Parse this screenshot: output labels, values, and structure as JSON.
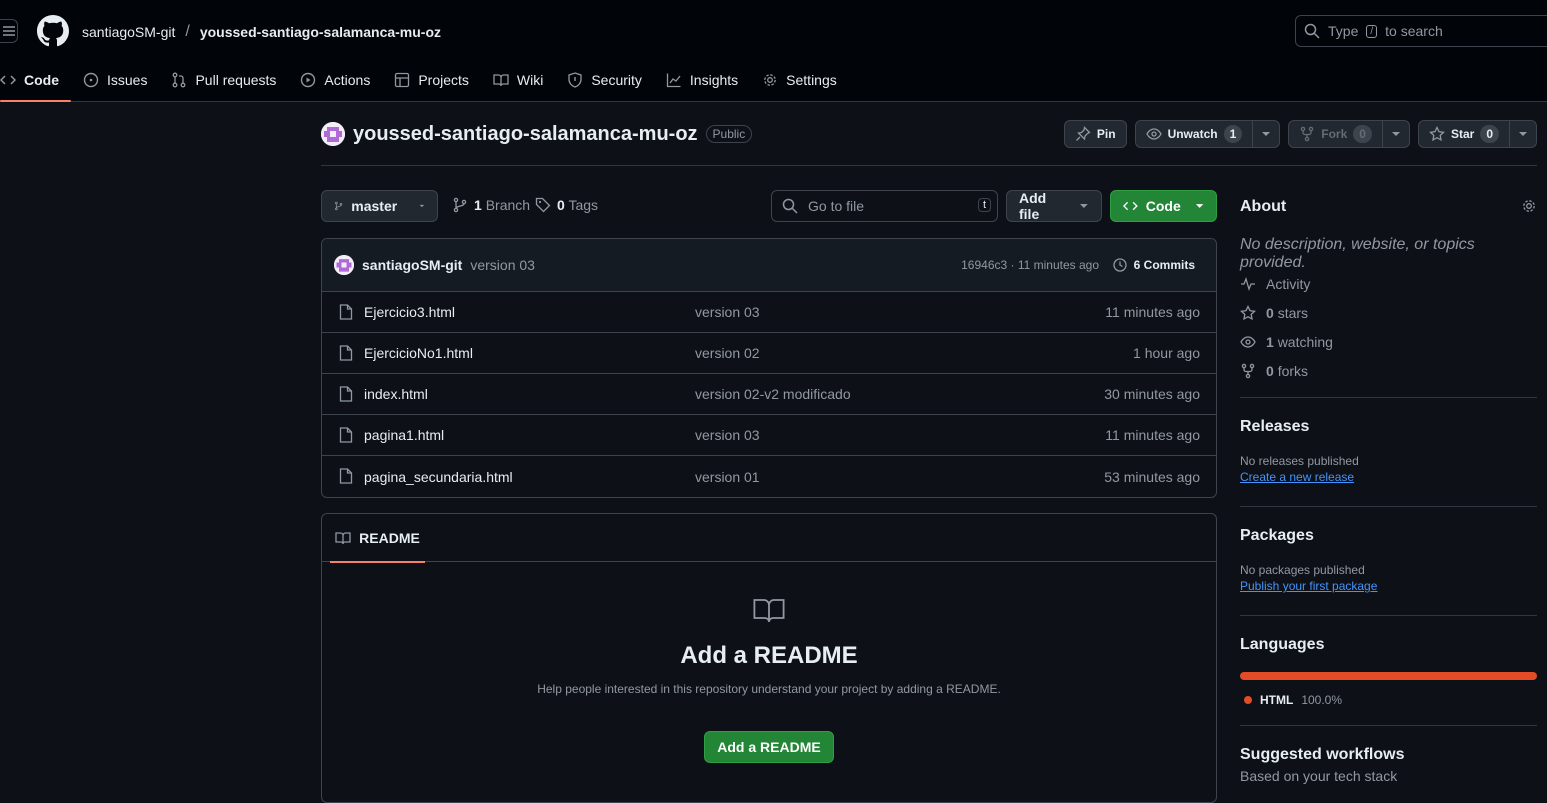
{
  "header": {
    "owner": "santiagoSM-git",
    "separator": "/",
    "repo": "youssed-santiago-salamanca-mu-oz",
    "search_placeholder_prefix": "Type",
    "search_key": "/",
    "search_placeholder_suffix": "to search"
  },
  "tabs": [
    {
      "label": "Code",
      "icon": "code-icon"
    },
    {
      "label": "Issues",
      "icon": "issue-icon"
    },
    {
      "label": "Pull requests",
      "icon": "pull-request-icon"
    },
    {
      "label": "Actions",
      "icon": "play-icon"
    },
    {
      "label": "Projects",
      "icon": "table-icon"
    },
    {
      "label": "Wiki",
      "icon": "book-icon"
    },
    {
      "label": "Security",
      "icon": "shield-icon"
    },
    {
      "label": "Insights",
      "icon": "graph-icon"
    },
    {
      "label": "Settings",
      "icon": "gear-icon"
    }
  ],
  "repo": {
    "name": "youssed-santiago-salamanca-mu-oz",
    "visibility": "Public",
    "pin": "Pin",
    "unwatch": "Unwatch",
    "watch_count": "1",
    "fork": "Fork",
    "fork_count": "0",
    "star": "Star",
    "star_count": "0"
  },
  "toolbar": {
    "branch": "master",
    "branch_count": "1",
    "branch_label": "Branch",
    "tag_count": "0",
    "tag_label": "Tags",
    "go_to_file": "Go to file",
    "go_to_file_key": "t",
    "add_file": "Add file",
    "code": "Code"
  },
  "commit": {
    "user": "santiagoSM-git",
    "message": "version 03",
    "sha_time": "16946c3 · 11 minutes ago",
    "commits": "6 Commits"
  },
  "files": [
    {
      "name": "Ejercicio3.html",
      "message": "version 03",
      "time": "11 minutes ago"
    },
    {
      "name": "EjercicioNo1.html",
      "message": "version 02",
      "time": "1 hour ago"
    },
    {
      "name": "index.html",
      "message": "version 02-v2 modificado",
      "time": "30 minutes ago"
    },
    {
      "name": "pagina1.html",
      "message": "version 03",
      "time": "11 minutes ago"
    },
    {
      "name": "pagina_secundaria.html",
      "message": "version 01",
      "time": "53 minutes ago"
    }
  ],
  "readme": {
    "tab": "README",
    "title": "Add a README",
    "text": "Help people interested in this repository understand your project by adding a README.",
    "button": "Add a README"
  },
  "about": {
    "title": "About",
    "description": "No description, website, or topics provided.",
    "activity": "Activity",
    "stars_count": "0",
    "stars_label": "stars",
    "watching_count": "1",
    "watching_label": "watching",
    "forks_count": "0",
    "forks_label": "forks"
  },
  "releases": {
    "title": "Releases",
    "empty": "No releases published",
    "link": "Create a new release"
  },
  "packages": {
    "title": "Packages",
    "empty": "No packages published",
    "link": "Publish your first package"
  },
  "languages": {
    "title": "Languages",
    "items": [
      {
        "name": "HTML",
        "percent": "100.0%",
        "color": "#e34c26",
        "fraction": 1.0
      }
    ]
  },
  "workflows": {
    "title": "Suggested workflows",
    "subtitle": "Based on your tech stack"
  },
  "colors": {
    "accent": "#f78166",
    "green": "#238636",
    "link": "#4493f8"
  }
}
